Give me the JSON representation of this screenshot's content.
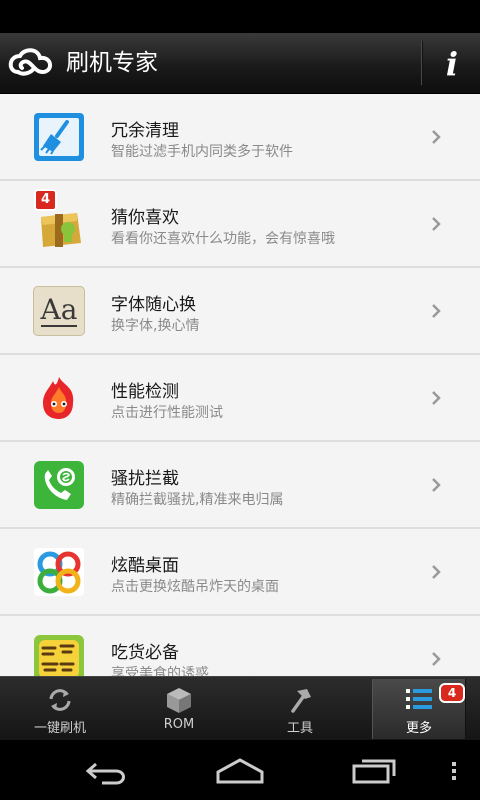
{
  "header": {
    "title": "刷机专家",
    "logo_icon": "cloud-logo-icon",
    "info_label": "i"
  },
  "list": {
    "items": [
      {
        "title": "冗余清理",
        "subtitle": "智能过滤手机内同类多于软件",
        "icon": "broom-icon"
      },
      {
        "title": "猜你喜欢",
        "subtitle": "看看你还喜欢什么功能，会有惊喜哦",
        "icon": "gift-box-icon",
        "badge": "4"
      },
      {
        "title": "字体随心换",
        "subtitle": "换字体,换心情",
        "icon": "font-aa-icon",
        "glyph": "Aa"
      },
      {
        "title": "性能检测",
        "subtitle": "点击进行性能测试",
        "icon": "flame-benchmark-icon"
      },
      {
        "title": "骚扰拦截",
        "subtitle": "精确拦截骚扰,精准来电归属",
        "icon": "phone-block-icon"
      },
      {
        "title": "炫酷桌面",
        "subtitle": "点击更换炫酷吊炸天的桌面",
        "icon": "launcher-icon"
      },
      {
        "title": "吃货必备",
        "subtitle": "享受美食的诱惑",
        "icon": "recipe-icon"
      }
    ]
  },
  "tabs": [
    {
      "label": "一键刷机",
      "icon": "refresh-icon"
    },
    {
      "label": "ROM",
      "icon": "box-icon"
    },
    {
      "label": "工具",
      "icon": "hammer-icon"
    },
    {
      "label": "更多",
      "icon": "list-icon",
      "badge": "4"
    }
  ],
  "nav": {
    "back_icon": "back-icon",
    "home_icon": "home-icon",
    "recents_icon": "recents-icon",
    "menu_icon": "menu-dots-icon"
  },
  "colors": {
    "badge": "#d9281e",
    "accent_blue": "#1f8fe0",
    "header_bg": "#1b1b1b"
  }
}
